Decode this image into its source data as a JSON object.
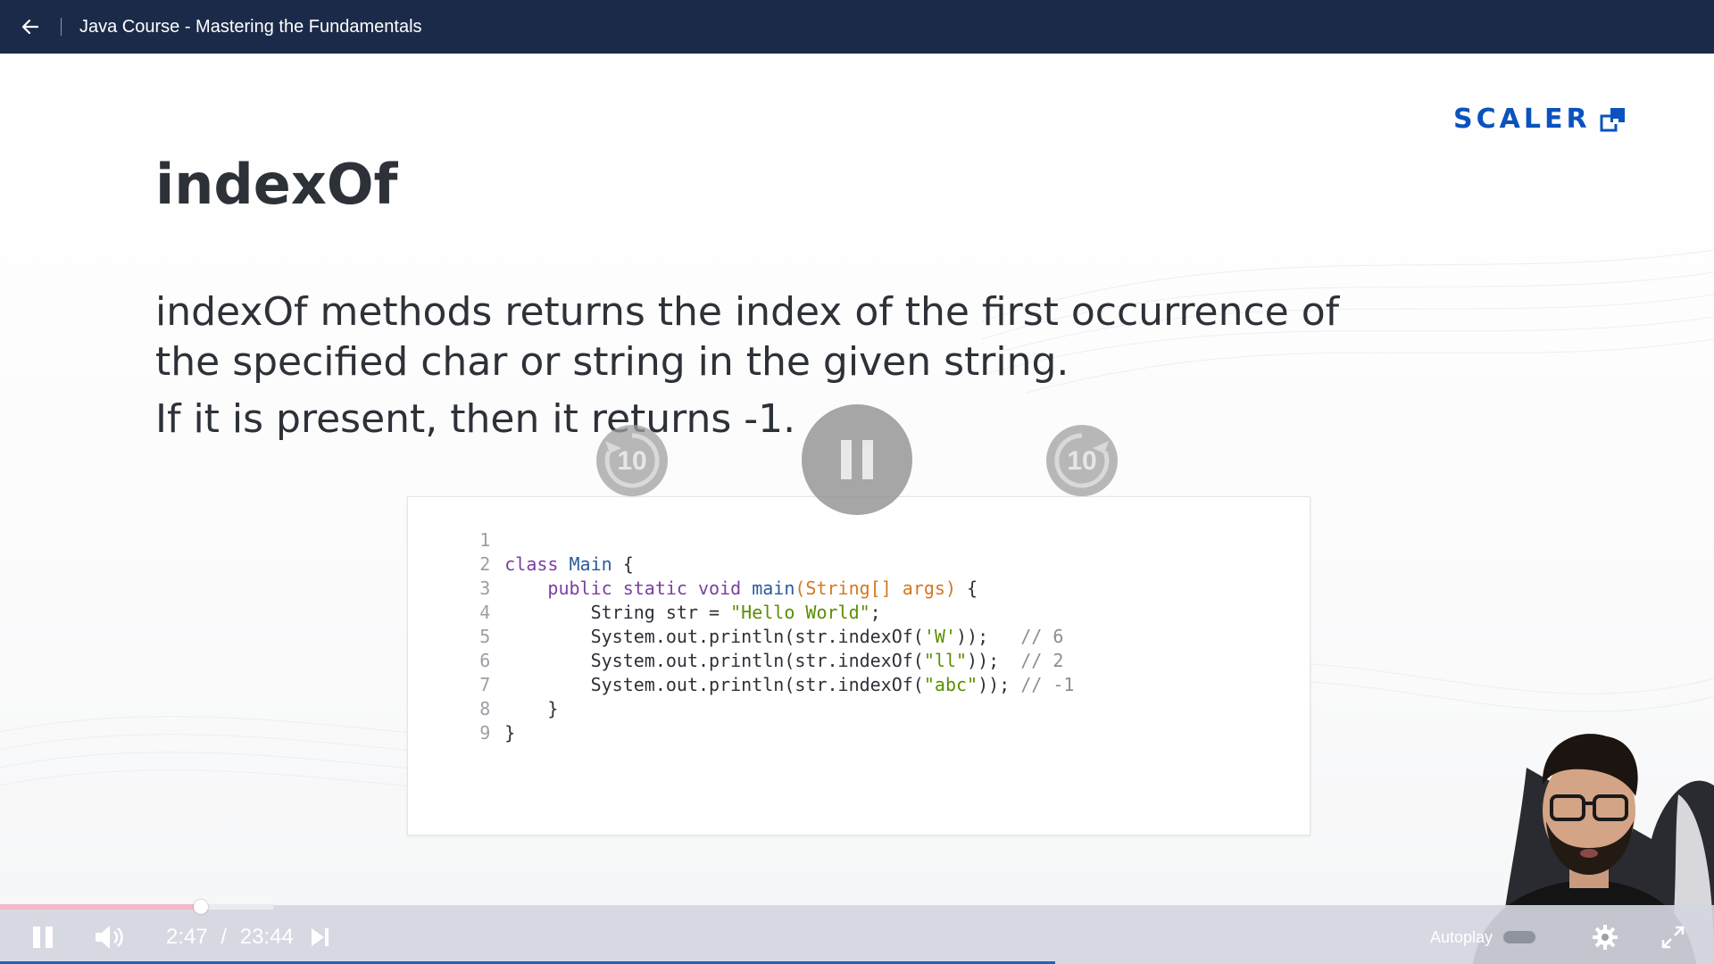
{
  "header": {
    "course_title": "Java Course - Mastering the Fundamentals"
  },
  "slide": {
    "brand": "SCALER",
    "title": "indexOf",
    "description": "indexOf methods returns the index of the first occurrence of the specified char or string in the given string.",
    "note": "If it is present, then it returns -1."
  },
  "code": {
    "lines": [
      {
        "num": "1"
      },
      {
        "num": "2",
        "p1": "class ",
        "p2": "Main",
        "p3": " {"
      },
      {
        "num": "3",
        "indent": "    ",
        "p1": "public static void ",
        "p2": "main",
        "p3": "(String[] args)",
        "p4": " {"
      },
      {
        "num": "4",
        "indent": "        ",
        "p1": "String str = ",
        "p2": "\"Hello World\"",
        "p3": ";"
      },
      {
        "num": "5",
        "indent": "        ",
        "p1": "System.out.println(str.indexOf(",
        "p2": "'W'",
        "p3": "));   ",
        "p4": "// 6"
      },
      {
        "num": "6",
        "indent": "        ",
        "p1": "System.out.println(str.indexOf(",
        "p2": "\"ll\"",
        "p3": "));  ",
        "p4": "// 2"
      },
      {
        "num": "7",
        "indent": "        ",
        "p1": "System.out.println(str.indexOf(",
        "p2": "\"abc\"",
        "p3": ")); ",
        "p4": "// -1"
      },
      {
        "num": "8",
        "indent": "    ",
        "p1": "}"
      },
      {
        "num": "9",
        "p1": "}"
      }
    ]
  },
  "overlay": {
    "rewind_label": "10",
    "forward_label": "10"
  },
  "player": {
    "current_time": "2:47",
    "separator": "/",
    "duration": "23:44",
    "progress_fraction": 0.117,
    "autoplay_label": "Autoplay"
  },
  "colors": {
    "header_bg": "#1c2a4a",
    "brand_blue": "#0a53be",
    "progress_pink": "#f4b8c8",
    "bottom_line": "#1f5fc4"
  },
  "icons": [
    "back-arrow-icon",
    "scaler-logo-icon",
    "rewind-10-icon",
    "pause-icon",
    "forward-10-icon",
    "volume-icon",
    "skip-next-icon",
    "settings-icon",
    "fullscreen-icon"
  ]
}
